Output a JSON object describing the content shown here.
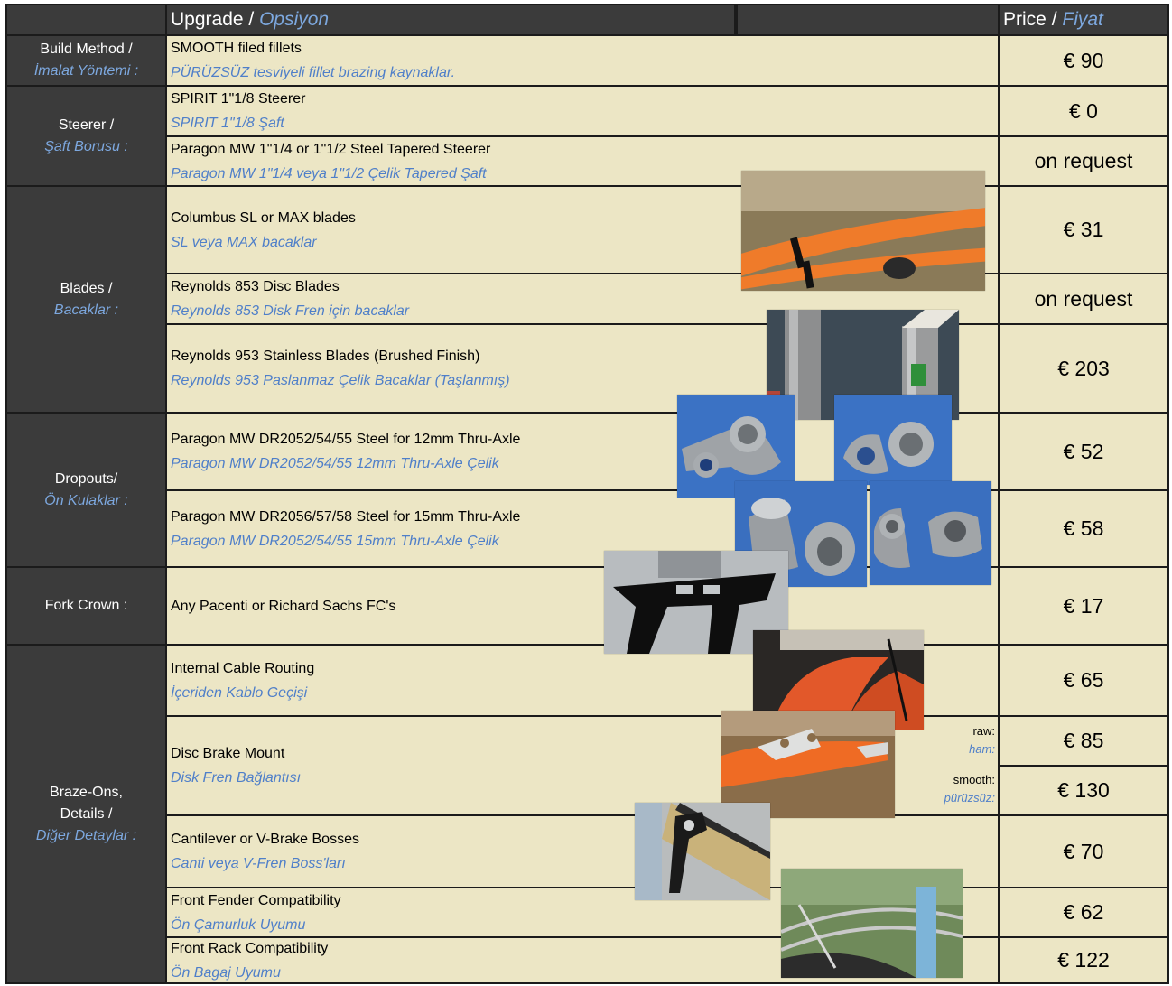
{
  "header": {
    "upgrade_en": "Upgrade",
    "upgrade_sep": " / ",
    "upgrade_tr": "Opsiyon",
    "price_en": "Price",
    "price_sep": " / ",
    "price_tr": "Fiyat"
  },
  "categories": {
    "build_method": {
      "en": "Build Method /",
      "tr": "İmalat Yöntemi  :"
    },
    "steerer": {
      "en": "Steerer /",
      "tr": "Şaft Borusu :"
    },
    "blades": {
      "en": "Blades /",
      "tr": "Bacaklar :"
    },
    "dropouts": {
      "en": "Dropouts/",
      "tr": "Ön Kulaklar :"
    },
    "fork_crown": {
      "en": "Fork Crown :",
      "tr": ""
    },
    "braze_ons": {
      "en": "Braze-Ons,",
      "en2": "Details /",
      "tr": "Diğer Detaylar :"
    }
  },
  "options": {
    "smooth_fillets": {
      "en": "SMOOTH filed fillets",
      "tr": "PÜRÜZSÜZ tesviyeli fillet brazing kaynaklar.",
      "price": "€ 90"
    },
    "spirit_steerer": {
      "en": "SPIRIT 1\"1/8 Steerer",
      "tr": "SPIRIT 1\"1/8 Şaft",
      "price": "€ 0"
    },
    "paragon_steerer": {
      "en": "Paragon MW 1\"1/4 or 1\"1/2 Steel Tapered Steerer",
      "tr": "Paragon MW 1\"1/4 veya 1\"1/2 Çelik Tapered Şaft",
      "price": "on request"
    },
    "columbus_blades": {
      "en": "Columbus SL or MAX  blades",
      "tr": "SL veya MAX bacaklar",
      "price": "€ 31"
    },
    "reynolds_853": {
      "en": "Reynolds 853 Disc Blades",
      "tr": "Reynolds 853 Disk Fren için bacaklar",
      "price": "on request"
    },
    "reynolds_953": {
      "en": "Reynolds 953 Stainless Blades (Brushed Finish)",
      "tr": "Reynolds 953 Paslanmaz Çelik Bacaklar (Taşlanmış)",
      "price": "€ 203"
    },
    "dropout_12mm": {
      "en": "Paragon MW DR2052/54/55 Steel for 12mm Thru-Axle",
      "tr": "Paragon MW DR2052/54/55 12mm Thru-Axle Çelik",
      "price": "€ 52"
    },
    "dropout_15mm": {
      "en": "Paragon MW DR2056/57/58 Steel for 15mm Thru-Axle",
      "tr": "Paragon MW DR2052/54/55 15mm Thru-Axle Çelik",
      "price": "€ 58"
    },
    "fork_crown": {
      "en": "Any Pacenti or Richard Sachs FC's",
      "price": "€ 17"
    },
    "internal_cable": {
      "en": "Internal Cable Routing",
      "tr": "İçeriden Kablo Geçişi",
      "price": "€ 65"
    },
    "disc_mount": {
      "en": "Disc Brake Mount",
      "tr": "Disk Fren Bağlantısı",
      "raw_en": "raw:",
      "raw_tr": "ham:",
      "raw_price": "€ 85",
      "smooth_en": "smooth:",
      "smooth_tr": "pürüzsüz:",
      "smooth_price": "€ 130"
    },
    "canti_bosses": {
      "en": "Cantilever or V-Brake Bosses",
      "tr": "Canti veya V-Fren Boss'ları",
      "price": "€ 70"
    },
    "fender": {
      "en": "Front Fender Compatibility",
      "tr": "Ön Çamurluk Uyumu",
      "price": "€ 62"
    },
    "rack": {
      "en": "Front Rack Compatibility",
      "tr": "Ön Bagaj Uyumu",
      "price": "€ 122"
    }
  },
  "photos": [
    "orange-fork-photo",
    "stainless-blades-photo",
    "dropout-12mm-photo-a",
    "dropout-12mm-photo-b",
    "dropout-15mm-photo-a",
    "dropout-15mm-photo-b",
    "fork-crown-photo",
    "internal-routing-photo",
    "disc-mount-photo",
    "canti-boss-photo",
    "front-rack-photo"
  ],
  "colors": {
    "dark": "#3b3b3b",
    "cream": "#ece6c5",
    "tr_text": "#4f7fc9",
    "tr_label": "#7da8df"
  }
}
